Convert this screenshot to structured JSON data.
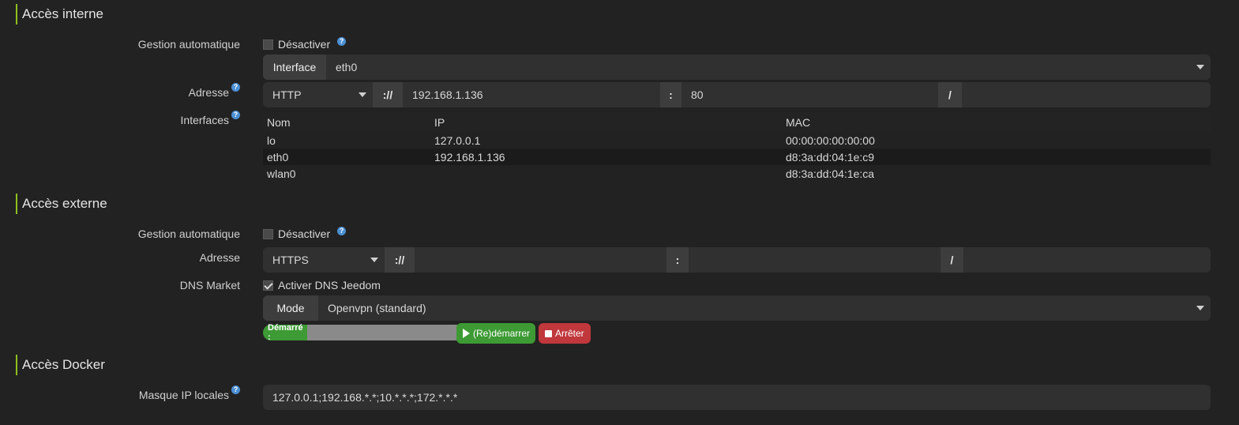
{
  "internal": {
    "title": "Accès interne",
    "auto_label": "Gestion automatique",
    "auto_checkbox": "Désactiver",
    "interface_addon": "Interface",
    "interface_value": "eth0",
    "address_label": "Adresse",
    "protocol": "HTTP",
    "scheme_sep": "://",
    "ip": "192.168.1.136",
    "colon": ":",
    "port": "80",
    "slash": "/",
    "interfaces_label": "Interfaces",
    "table": {
      "headers": [
        "Nom",
        "IP",
        "MAC"
      ],
      "rows": [
        [
          "lo",
          "127.0.0.1",
          "00:00:00:00:00:00"
        ],
        [
          "eth0",
          "192.168.1.136",
          "d8:3a:dd:04:1e:c9"
        ],
        [
          "wlan0",
          "",
          "d8:3a:dd:04:1e:ca"
        ]
      ]
    }
  },
  "external": {
    "title": "Accès externe",
    "auto_label": "Gestion automatique",
    "auto_checkbox": "Désactiver",
    "address_label": "Adresse",
    "protocol": "HTTPS",
    "scheme_sep": "://",
    "colon": ":",
    "slash": "/",
    "dns_label": "DNS Market",
    "dns_checkbox": "Activer DNS Jeedom",
    "mode_addon": "Mode",
    "mode_value": "Openvpn (standard)",
    "status_text": "Démarré :",
    "restart_button": "(Re)démarrer",
    "stop_button": "Arrêter"
  },
  "docker": {
    "title": "Accès Docker",
    "mask_label": "Masque IP locales",
    "mask_value": "127.0.0.1;192.168.*.*;10.*.*.*;172.*.*.*"
  },
  "colors": {
    "accent": "#8fbf1f",
    "success": "#3d9a34",
    "danger": "#c0373c",
    "help": "#4a8fd4"
  },
  "icons": [
    "help-icon",
    "caret-down-icon",
    "checkmark-icon",
    "play-icon",
    "stop-icon"
  ]
}
